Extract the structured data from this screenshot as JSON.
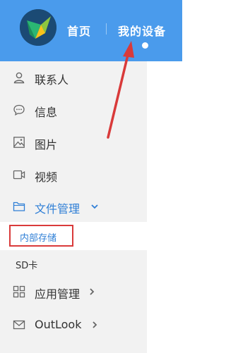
{
  "header": {
    "home_label": "首页",
    "device_label": "我的设备",
    "background_color": "#4a9bec"
  },
  "sidebar": {
    "items": [
      {
        "label": "联系人",
        "icon": "person-icon"
      },
      {
        "label": "信息",
        "icon": "chat-bubble-icon"
      },
      {
        "label": "图片",
        "icon": "image-icon"
      },
      {
        "label": "视频",
        "icon": "video-icon"
      },
      {
        "label": "文件管理",
        "icon": "folder-icon",
        "expanded": true,
        "children": [
          {
            "label": "内部存储",
            "selected": true
          },
          {
            "label": "SD卡",
            "selected": false
          }
        ]
      },
      {
        "label": "应用管理",
        "icon": "grid-icon",
        "expanded": false
      },
      {
        "label": "OutLook",
        "icon": "mail-icon",
        "expanded": false
      }
    ]
  },
  "colors": {
    "accent": "#2f7fd6",
    "annotation": "#d93a3a",
    "sidebar_bg": "#f2f2f2"
  }
}
